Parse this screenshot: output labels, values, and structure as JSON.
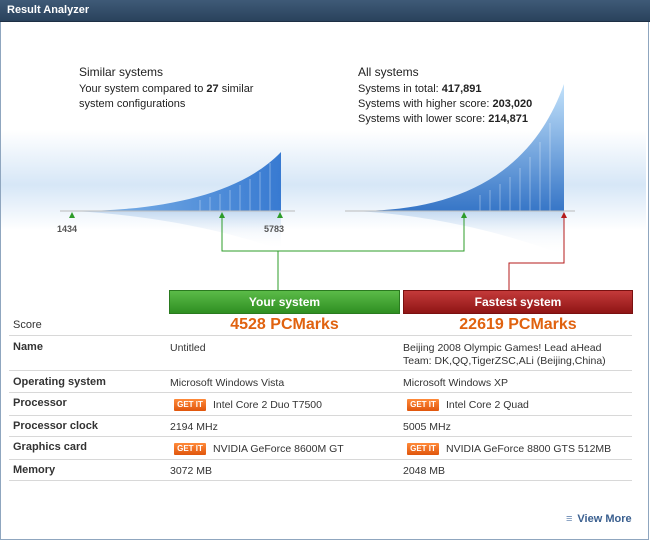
{
  "window": {
    "title": "Result Analyzer"
  },
  "similar": {
    "title": "Similar systems",
    "desc_pre": "Your system compared to ",
    "desc_count": "27",
    "desc_post": " similar",
    "desc_line2": "system configurations",
    "min_label": "1434",
    "max_label": "5783"
  },
  "all": {
    "title": "All systems",
    "total_label": "Systems in total: ",
    "total": "417,891",
    "higher_label": "Systems with higher score: ",
    "higher": "203,020",
    "lower_label": "Systems with lower score: ",
    "lower": "214,871"
  },
  "columns": {
    "yours": "Your system",
    "fastest": "Fastest system"
  },
  "rows": {
    "score": {
      "label": "Score",
      "yours": "4528 PCMarks",
      "fastest": "22619 PCMarks"
    },
    "name": {
      "label": "Name",
      "yours": "Untitled",
      "fastest_1": "Beijing 2008 Olympic Games! Lead aHead",
      "fastest_2": "Team: DK,QQ,TigerZSC,ALi (Beijing,China)"
    },
    "os": {
      "label": "Operating system",
      "yours": "Microsoft Windows Vista",
      "fastest": "Microsoft Windows XP"
    },
    "processor": {
      "label": "Processor",
      "yours": "Intel Core 2 Duo T7500",
      "fastest": "Intel Core 2 Quad"
    },
    "clock": {
      "label": "Processor clock",
      "yours": "2194 MHz",
      "fastest": "5005 MHz"
    },
    "graphics": {
      "label": "Graphics card",
      "yours": "NVIDIA GeForce 8600M GT",
      "fastest": "NVIDIA GeForce 8800 GTS 512MB"
    },
    "memory": {
      "label": "Memory",
      "yours": "3072 MB",
      "fastest": "2048 MB"
    }
  },
  "getit_label": "GET IT",
  "footer": {
    "view_more": "View More",
    "icon": "list-icon"
  },
  "colors": {
    "accent_green": "#2f8f22",
    "accent_red": "#8f1515",
    "score_orange": "#e0620f"
  }
}
